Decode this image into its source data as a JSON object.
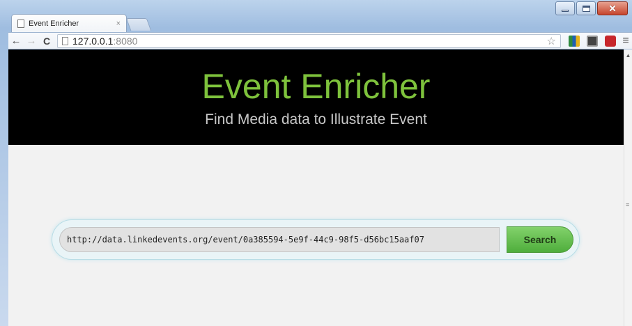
{
  "browser": {
    "tab_title": "Event Enricher",
    "tab_close": "×",
    "url_host": "127.0.0.1",
    "url_port": ":8080"
  },
  "page": {
    "title": "Event Enricher",
    "subtitle": "Find Media data to Illustrate Event",
    "search_value": "http://data.linkedevents.org/event/0a385594-5e9f-44c9-98f5-d56bc15aaf07",
    "search_button": "Search"
  },
  "colors": {
    "title_green": "#7ec23c",
    "header_bg": "#000000",
    "button_green": "#5fbe49"
  },
  "icons": [
    "page-icon",
    "back-arrow-icon",
    "forward-arrow-icon",
    "reload-icon",
    "bookmark-star-icon",
    "extension-icon",
    "menu-icon",
    "minimize-icon",
    "maximize-icon",
    "close-icon"
  ]
}
